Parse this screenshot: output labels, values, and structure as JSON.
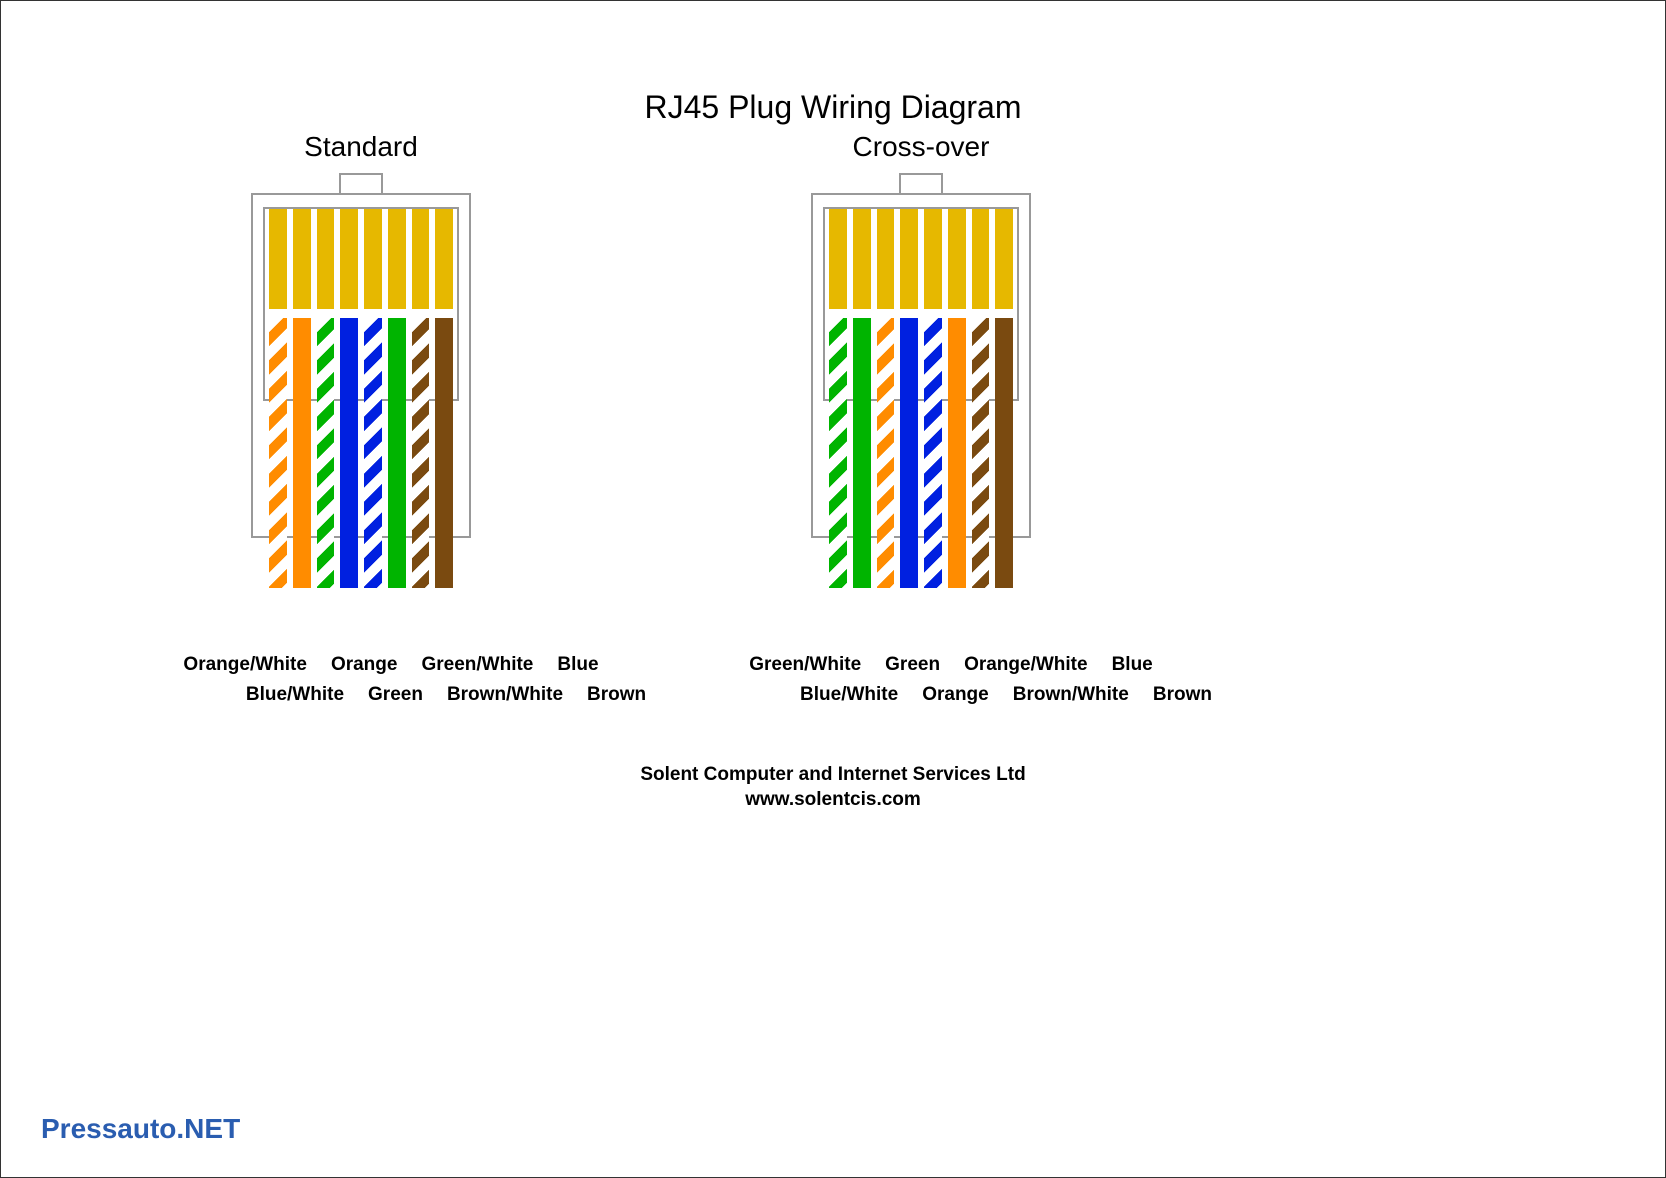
{
  "title": "RJ45 Plug Wiring Diagram",
  "plugs": {
    "standard": {
      "name": "Standard",
      "wires": [
        {
          "type": "striped",
          "color": "#ff8c00",
          "label": "Orange/White"
        },
        {
          "type": "solid",
          "color": "#ff8c00",
          "label": "Orange"
        },
        {
          "type": "striped",
          "color": "#00b400",
          "label": "Green/White"
        },
        {
          "type": "solid",
          "color": "#0020e0",
          "label": "Blue"
        },
        {
          "type": "striped",
          "color": "#0020e0",
          "label": "Blue/White"
        },
        {
          "type": "solid",
          "color": "#00b400",
          "label": "Green"
        },
        {
          "type": "striped",
          "color": "#7a4a10",
          "label": "Brown/White"
        },
        {
          "type": "solid",
          "color": "#7a4a10",
          "label": "Brown"
        }
      ]
    },
    "crossover": {
      "name": "Cross-over",
      "wires": [
        {
          "type": "striped",
          "color": "#00b400",
          "label": "Green/White"
        },
        {
          "type": "solid",
          "color": "#00b400",
          "label": "Green"
        },
        {
          "type": "striped",
          "color": "#ff8c00",
          "label": "Orange/White"
        },
        {
          "type": "solid",
          "color": "#0020e0",
          "label": "Blue"
        },
        {
          "type": "striped",
          "color": "#0020e0",
          "label": "Blue/White"
        },
        {
          "type": "solid",
          "color": "#ff8c00",
          "label": "Orange"
        },
        {
          "type": "striped",
          "color": "#7a4a10",
          "label": "Brown/White"
        },
        {
          "type": "solid",
          "color": "#7a4a10",
          "label": "Brown"
        }
      ]
    }
  },
  "pin_color": "#e6b800",
  "footer_line1": "Solent Computer and Internet Services Ltd",
  "footer_line2": "www.solentcis.com",
  "watermark": "Pressauto.NET"
}
